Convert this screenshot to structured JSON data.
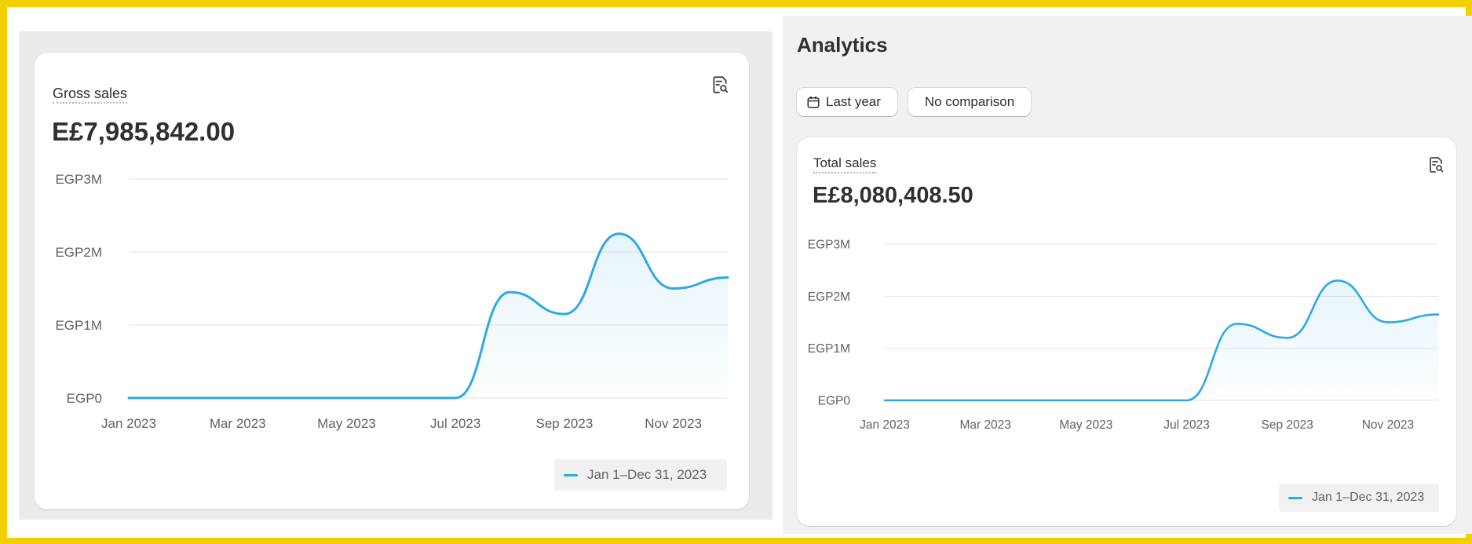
{
  "colors": {
    "accent": "#2da9e6",
    "page_bg": "#f1f1f1",
    "card_bg": "#ffffff",
    "highlight_border": "#f5d000"
  },
  "icons": {
    "report": "report-search-icon",
    "calendar": "calendar-icon"
  },
  "analytics": {
    "title": "Analytics",
    "date_button_label": "Last year",
    "comparison_button_label": "No comparison"
  },
  "gross_sales": {
    "title": "Gross sales",
    "value": "E£7,985,842.00",
    "legend_label": "Jan 1–Dec 31, 2023"
  },
  "total_sales": {
    "title": "Total sales",
    "value": "E£8,080,408.50",
    "legend_label": "Jan 1–Dec 31, 2023"
  },
  "chart_data": [
    {
      "type": "area",
      "title": "Gross sales",
      "x": [
        "Jan 2023",
        "Feb 2023",
        "Mar 2023",
        "Apr 2023",
        "May 2023",
        "Jun 2023",
        "Jul 2023",
        "Aug 2023",
        "Sep 2023",
        "Oct 2023",
        "Nov 2023",
        "Dec 2023"
      ],
      "x_tick_labels": [
        "Jan 2023",
        "Mar 2023",
        "May 2023",
        "Jul 2023",
        "Sep 2023",
        "Nov 2023"
      ],
      "y_tick_labels": [
        "EGP0",
        "EGP1M",
        "EGP2M",
        "EGP3M"
      ],
      "y_tick_values": [
        0,
        1000000,
        2000000,
        3000000
      ],
      "ylim": [
        0,
        3000000
      ],
      "series": [
        {
          "name": "Jan 1–Dec 31, 2023",
          "values": [
            0,
            0,
            0,
            0,
            0,
            0,
            0,
            1450000,
            1150000,
            2250000,
            1500000,
            1650000
          ]
        }
      ],
      "grid": true,
      "legend_position": "bottom-right"
    },
    {
      "type": "area",
      "title": "Total sales",
      "x": [
        "Jan 2023",
        "Feb 2023",
        "Mar 2023",
        "Apr 2023",
        "May 2023",
        "Jun 2023",
        "Jul 2023",
        "Aug 2023",
        "Sep 2023",
        "Oct 2023",
        "Nov 2023",
        "Dec 2023"
      ],
      "x_tick_labels": [
        "Jan 2023",
        "Mar 2023",
        "May 2023",
        "Jul 2023",
        "Sep 2023",
        "Nov 2023"
      ],
      "y_tick_labels": [
        "EGP0",
        "EGP1M",
        "EGP2M",
        "EGP3M"
      ],
      "y_tick_values": [
        0,
        1000000,
        2000000,
        3000000
      ],
      "ylim": [
        0,
        3000000
      ],
      "series": [
        {
          "name": "Jan 1–Dec 31, 2023",
          "values": [
            0,
            0,
            0,
            0,
            0,
            0,
            0,
            1470000,
            1200000,
            2300000,
            1500000,
            1650000
          ]
        }
      ],
      "grid": true,
      "legend_position": "bottom-right"
    }
  ]
}
